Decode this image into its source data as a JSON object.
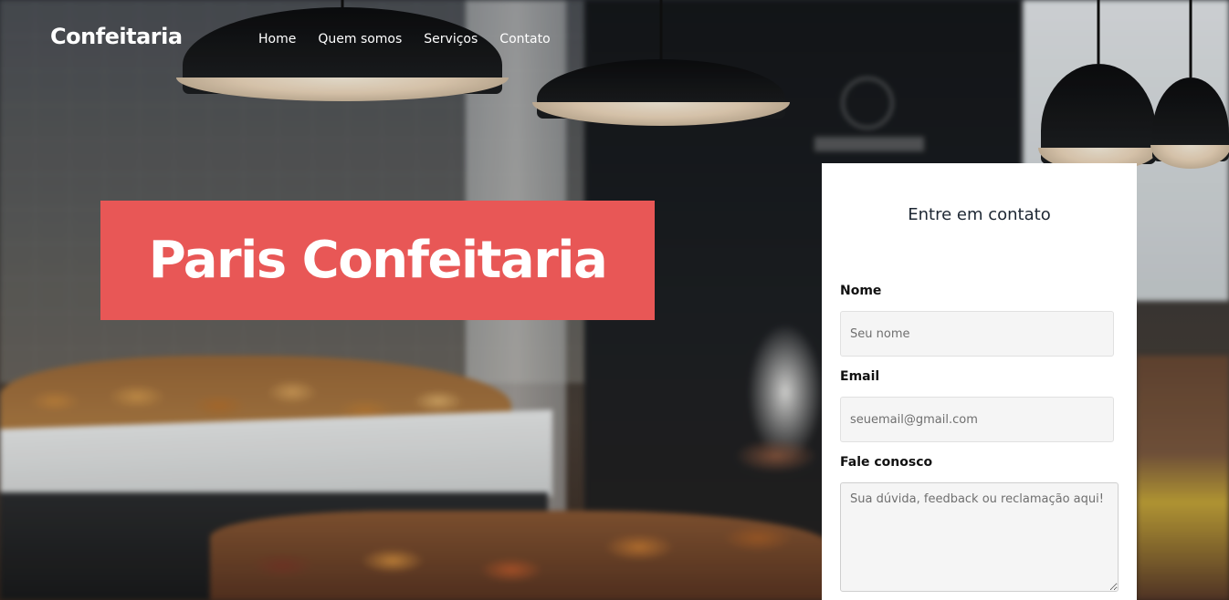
{
  "header": {
    "brand": "Confeitaria",
    "nav": [
      {
        "label": "Home"
      },
      {
        "label": "Quem somos"
      },
      {
        "label": "Serviços"
      },
      {
        "label": "Contato"
      }
    ]
  },
  "hero": {
    "title": "Paris Confeitaria",
    "accent_color": "#e85756"
  },
  "contact": {
    "title": "Entre em contato",
    "name": {
      "label": "Nome",
      "placeholder": "Seu nome"
    },
    "email": {
      "label": "Email",
      "placeholder": "seuemail@gmail.com"
    },
    "message": {
      "label": "Fale conosco",
      "placeholder": "Sua dúvida, feedback ou reclamação aqui!"
    }
  }
}
